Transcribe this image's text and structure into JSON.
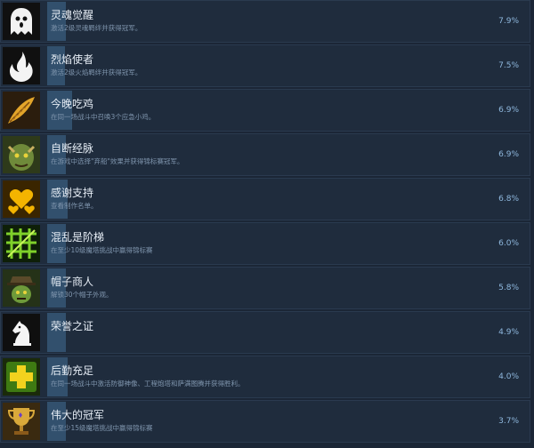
{
  "achievements": [
    {
      "title": "灵魂觉醒",
      "desc": "激活2级灵魂羁绊并获得冠军。",
      "percent": "7.9%",
      "progress": 0.079,
      "icon": "ghost-icon",
      "icon_bg": "#101010"
    },
    {
      "title": "烈焰使者",
      "desc": "激活2级火焰羁绊并获得冠军。",
      "percent": "7.5%",
      "progress": 0.075,
      "icon": "flame-icon",
      "icon_bg": "#101010"
    },
    {
      "title": "今晚吃鸡",
      "desc": "在同一场战斗中召唤3个应急小鸡。",
      "percent": "6.9%",
      "progress": 0.069,
      "icon": "feather-icon",
      "icon_bg": "#2b1d0d"
    },
    {
      "title": "自断经脉",
      "desc": "在游戏中选择\"弃船\"效果并获得锦标赛冠军。",
      "percent": "6.9%",
      "progress": 0.069,
      "icon": "ogre-portrait-icon",
      "icon_bg": "#2e3a1a"
    },
    {
      "title": "感谢支持",
      "desc": "查看制作名单。",
      "percent": "6.8%",
      "progress": 0.068,
      "icon": "hearts-icon",
      "icon_bg": "#3a2500"
    },
    {
      "title": "混乱是阶梯",
      "desc": "在至少10级魔塔挑战中赢得锦标赛",
      "percent": "6.0%",
      "progress": 0.06,
      "icon": "green-grid-icon",
      "icon_bg": "#0e1f08"
    },
    {
      "title": "帽子商人",
      "desc": "解锁30个帽子外观。",
      "percent": "5.8%",
      "progress": 0.058,
      "icon": "goblin-hat-icon",
      "icon_bg": "#253218"
    },
    {
      "title": "荣誉之证",
      "desc": "",
      "percent": "4.9%",
      "progress": 0.049,
      "icon": "chess-knight-icon",
      "icon_bg": "#0f0f0f"
    },
    {
      "title": "后勤充足",
      "desc": "在同一场战斗中激活防御神像、工程炮塔和萨满图腾并获得胜利。",
      "percent": "4.0%",
      "progress": 0.04,
      "icon": "green-cross-icon",
      "icon_bg": "#1a2a0a"
    },
    {
      "title": "伟大的冠军",
      "desc": "在至少15级魔塔挑战中赢得锦标赛",
      "percent": "3.7%",
      "progress": 0.037,
      "icon": "trophy-icon",
      "icon_bg": "#3a2a10"
    }
  ],
  "colors": {
    "row_bg": "#1f2c3d",
    "bar": "#3a5c7d",
    "title": "#e6edf5",
    "desc": "#7f95ad",
    "percent": "#8fb8de"
  }
}
